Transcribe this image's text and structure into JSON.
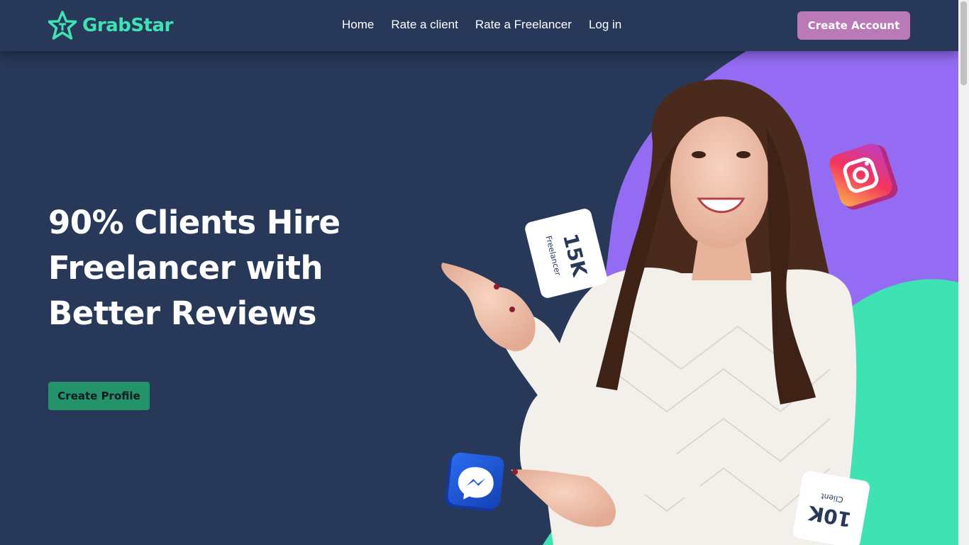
{
  "brand": {
    "name": "GrabStar",
    "color": "#3fe2b3",
    "logo_icon": "star-icon"
  },
  "nav": {
    "items": [
      {
        "label": "Home"
      },
      {
        "label": "Rate a client"
      },
      {
        "label": "Rate a Freelancer"
      },
      {
        "label": "Log in"
      }
    ],
    "cta": "Create Account"
  },
  "hero": {
    "headline_lines": [
      "90% Clients Hire",
      "Freelancer with",
      "Better Reviews"
    ],
    "cta": "Create Profile"
  },
  "cards": {
    "freelancer": {
      "value": "15K",
      "label": "Freelancer"
    },
    "client": {
      "value": "10K",
      "label": "Client"
    }
  },
  "icons": [
    "instagram-icon",
    "messenger-icon"
  ],
  "colors": {
    "background": "#273859",
    "accent_purple": "#946cf4",
    "accent_green": "#3fe2b3",
    "button_pink": "#b97ab7",
    "button_green": "#23936a"
  }
}
